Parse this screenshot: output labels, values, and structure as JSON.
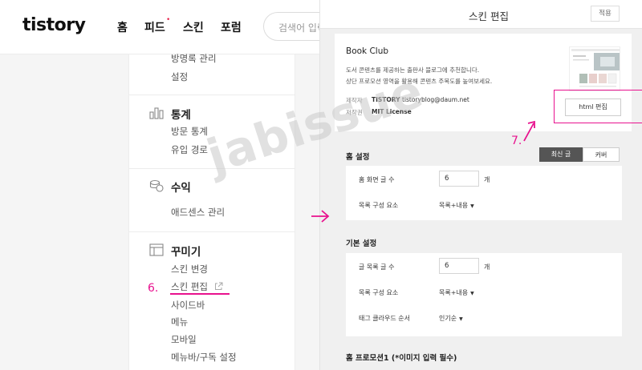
{
  "left": {
    "logo": "tistory",
    "nav": [
      "홈",
      "피드",
      "스킨",
      "포럼"
    ],
    "nav_dot": "•",
    "search_placeholder": "검색어 입력",
    "menu": {
      "top_items": [
        "방명록 관리",
        "설정"
      ],
      "stats": {
        "heading": "통계",
        "items": [
          "방문 통계",
          "유입 경로"
        ]
      },
      "revenue": {
        "heading": "수익",
        "items": [
          "애드센스 관리"
        ]
      },
      "decorate": {
        "heading": "꾸미기",
        "items": [
          "스킨 변경",
          "스킨 편집",
          "사이드바",
          "메뉴",
          "모바일",
          "메뉴바/구독 설정"
        ]
      }
    },
    "step6": "6."
  },
  "right": {
    "title": "스킨 편집",
    "apply_label": "적용",
    "skin_name": "Book Club",
    "desc_line1": "도서 콘텐츠를 제공하는 출판사 블로그에 추천합니다.",
    "desc_line2": "상단 프로모션 영역을 활용해 콘텐츠 주목도를 높여보세요.",
    "maker_label": "제작자",
    "maker_name": "TISTORY",
    "maker_email": "tistoryblog@daum.net",
    "license_label": "저작권",
    "license_value": "MIT License",
    "html_edit_label": "html 편집",
    "step7": "7.",
    "home_settings": {
      "title": "홈 설정",
      "tabs": [
        "최신 글",
        "커버"
      ],
      "post_count_label": "홈 화면 글 수",
      "post_count_value": "6",
      "unit": "개",
      "list_label": "목록 구성 요소",
      "list_value": "목록+내용"
    },
    "basic_settings": {
      "title": "기본 설정",
      "post_count_label": "글 목록 글 수",
      "post_count_value": "6",
      "unit": "개",
      "list_label": "목록 구성 요소",
      "list_value": "목록+내용",
      "tag_label": "태그 클라우드 순서",
      "tag_value": "인기순"
    },
    "promo_title": "홈 프로모션1 (*이미지 입력 필수)"
  },
  "watermark": "jabissue",
  "colors": {
    "annotation_pink": "#e8118e",
    "active_tab": "#555555",
    "nav_dot": "#e8274f"
  }
}
